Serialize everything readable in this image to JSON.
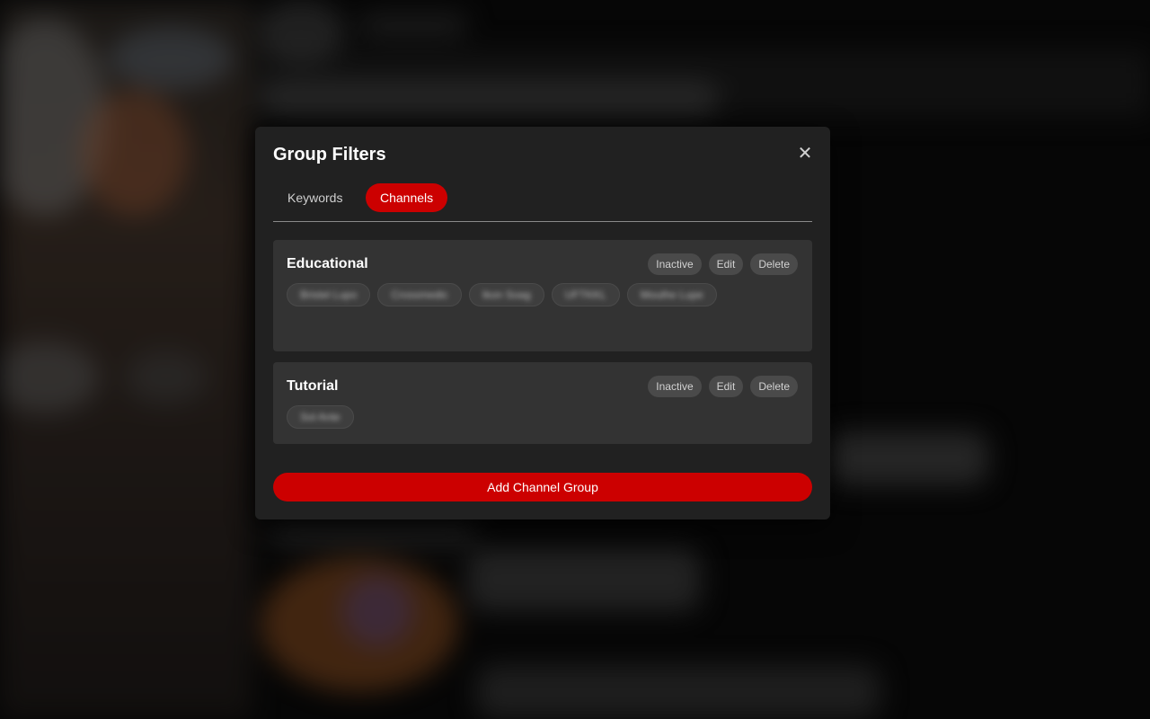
{
  "modal": {
    "title": "Group Filters",
    "close_icon": "close-icon",
    "tabs": [
      {
        "label": "Keywords",
        "active": false
      },
      {
        "label": "Channels",
        "active": true
      }
    ],
    "groups": [
      {
        "name": "Educational",
        "actions": {
          "inactive": "Inactive",
          "edit": "Edit",
          "delete": "Delete"
        },
        "channels": [
          "Bristel Lupo",
          "Crossmedic",
          "Ikon Soag",
          "UFTKKL",
          "Mouthe Lupe"
        ]
      },
      {
        "name": "Tutorial",
        "actions": {
          "inactive": "Inactive",
          "edit": "Edit",
          "delete": "Delete"
        },
        "channels": [
          "Sol Ante"
        ]
      }
    ],
    "add_button": "Add Channel Group"
  },
  "colors": {
    "accent": "#cc0000",
    "modal_bg": "#212121",
    "card_bg": "#333333",
    "pill_bg": "#4a4a4a"
  }
}
